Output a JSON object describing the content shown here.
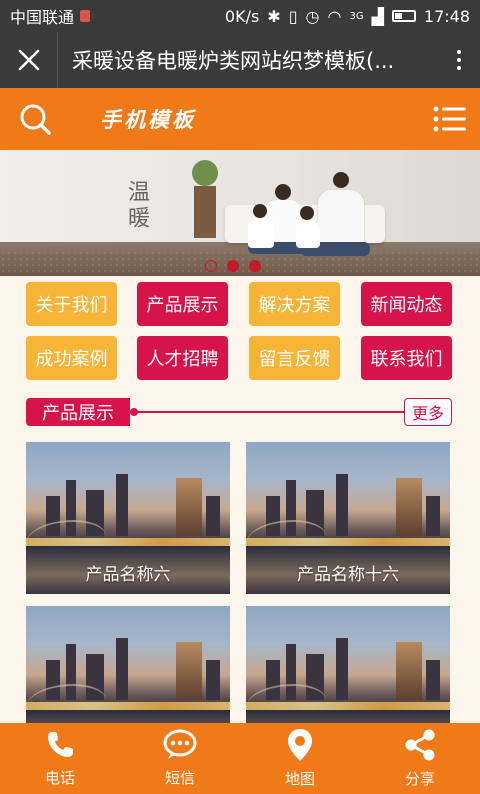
{
  "status_bar": {
    "carrier": "中国联通",
    "speed": "0K/s",
    "network": "3G",
    "time": "17:48"
  },
  "title_bar": {
    "title": "采暖设备电暖炉类网站织梦模板(..."
  },
  "header": {
    "logo_text": "手机模板"
  },
  "banner": {
    "headline": "温暖",
    "slides_count": 3,
    "active_index": 0
  },
  "nav": {
    "items": [
      {
        "label": "关于我们",
        "color": "#f7b437"
      },
      {
        "label": "产品展示",
        "color": "#d6134a"
      },
      {
        "label": "解决方案",
        "color": "#f7b437"
      },
      {
        "label": "新闻动态",
        "color": "#d6134a"
      },
      {
        "label": "成功案例",
        "color": "#f7b437"
      },
      {
        "label": "人才招聘",
        "color": "#d6134a"
      },
      {
        "label": "留言反馈",
        "color": "#f7b437"
      },
      {
        "label": "联系我们",
        "color": "#d6134a"
      }
    ]
  },
  "products_section": {
    "title": "产品展示",
    "more_label": "更多",
    "items": [
      {
        "name": "产品名称六"
      },
      {
        "name": "产品名称十六"
      },
      {
        "name": ""
      },
      {
        "name": ""
      }
    ]
  },
  "bottom_nav": {
    "items": [
      {
        "label": "电话",
        "icon": "phone-icon"
      },
      {
        "label": "短信",
        "icon": "sms-icon"
      },
      {
        "label": "地图",
        "icon": "map-pin-icon"
      },
      {
        "label": "分享",
        "icon": "share-icon"
      }
    ]
  },
  "colors": {
    "header_orange": "#f07a18",
    "accent_red": "#d6134a",
    "accent_yellow": "#f7b437",
    "page_bg": "#fdf6ec",
    "dark_bar": "#3a3a3a"
  }
}
